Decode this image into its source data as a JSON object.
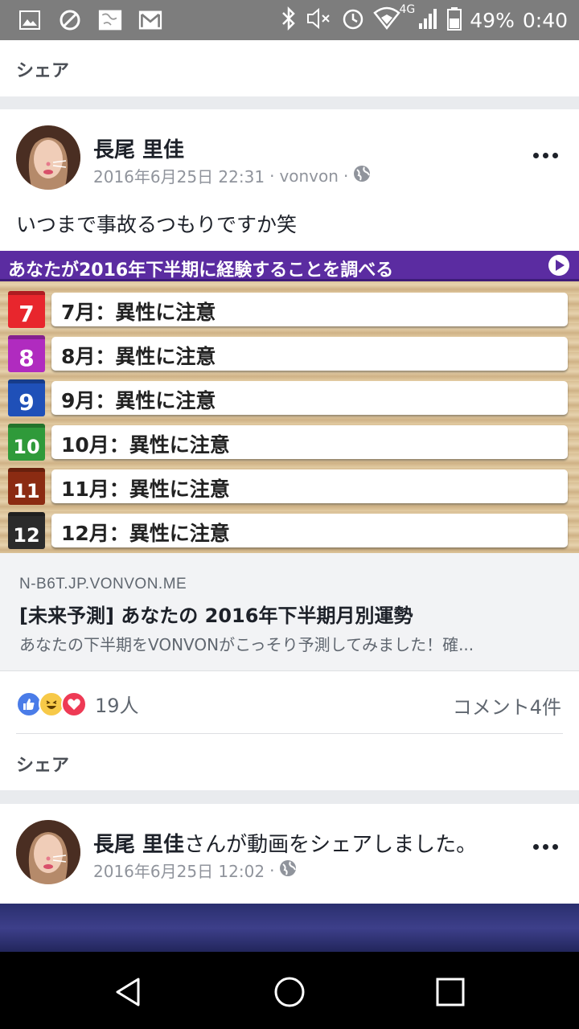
{
  "status_bar": {
    "battery": "49%",
    "time": "0:40",
    "network": "4G",
    "icons": [
      "image-icon",
      "block-icon",
      "app-icon",
      "gmail-icon",
      "bluetooth-icon",
      "mute-icon",
      "alarm-icon",
      "wifi-icon",
      "signal-icon",
      "battery-icon"
    ]
  },
  "top_share": {
    "label": "シェア"
  },
  "post1": {
    "author": "長尾 里佳",
    "date": "2016年6月25日 22:31",
    "via": "vonvon",
    "text": "いつまで事故るつもりですか笑",
    "image": {
      "header": "あなたが2016年下半期に経験することを調べる",
      "rows": [
        {
          "num": "7",
          "text": "7月：異性に注意",
          "color": "#e8262d"
        },
        {
          "num": "8",
          "text": "8月：異性に注意",
          "color": "#b02bbf"
        },
        {
          "num": "9",
          "text": "9月：異性に注意",
          "color": "#1f50b8"
        },
        {
          "num": "10",
          "text": "10月：異性に注意",
          "color": "#2f9a3a"
        },
        {
          "num": "11",
          "text": "11月：異性に注意",
          "color": "#8b2b12"
        },
        {
          "num": "12",
          "text": "12月：異性に注意",
          "color": "#2b2b2b"
        }
      ]
    },
    "link": {
      "domain": "N-B6T.JP.VONVON.ME",
      "title": "[未来予測] あなたの 2016年下半期月別運勢",
      "description": "あなたの下半期をVONVONがこっそり予測してみました！確..."
    },
    "reactions": {
      "count": "19人",
      "comments": "コメント4件"
    },
    "share_label": "シェア"
  },
  "post2": {
    "author": "長尾 里佳",
    "action": "さんが動画をシェアしました。",
    "date": "2016年6月25日 12:02"
  },
  "colors": {
    "facebook_blue": "#4a7ce8",
    "status_bar": "#7d7d7d",
    "image_header": "#5b2ca1"
  }
}
